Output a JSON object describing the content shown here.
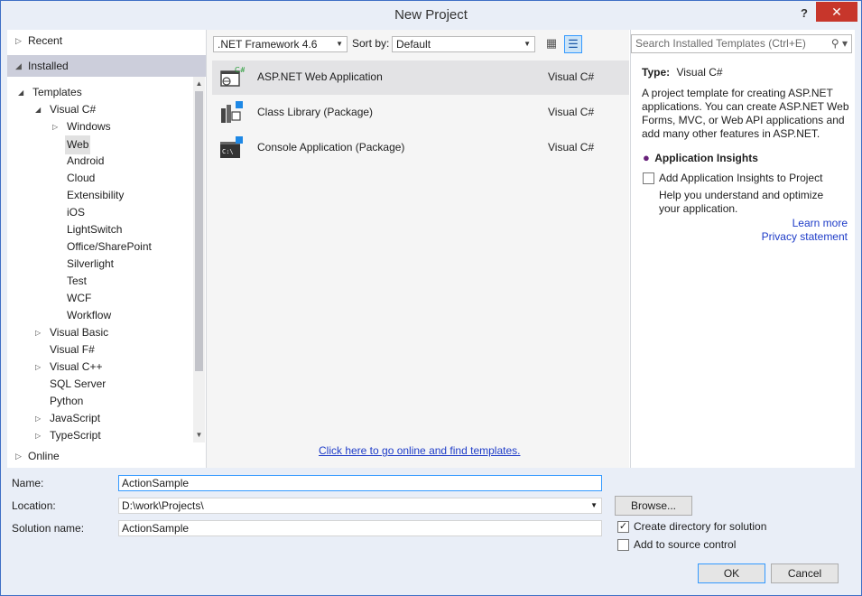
{
  "window": {
    "title": "New Project",
    "help_label": "?",
    "close_label": "✕"
  },
  "left_panel": {
    "recent": "Recent",
    "installed": "Installed",
    "online": "Online",
    "tree": [
      {
        "label": "Templates",
        "level": 0,
        "expander": "◢",
        "selected": false
      },
      {
        "label": "Visual C#",
        "level": 1,
        "expander": "◢",
        "selected": false
      },
      {
        "label": "Windows",
        "level": 2,
        "expander": "▷",
        "selected": false
      },
      {
        "label": "Web",
        "level": 2,
        "expander": "",
        "selected": true
      },
      {
        "label": "Android",
        "level": 2,
        "expander": "",
        "selected": false
      },
      {
        "label": "Cloud",
        "level": 2,
        "expander": "",
        "selected": false
      },
      {
        "label": "Extensibility",
        "level": 2,
        "expander": "",
        "selected": false
      },
      {
        "label": "iOS",
        "level": 2,
        "expander": "",
        "selected": false
      },
      {
        "label": "LightSwitch",
        "level": 2,
        "expander": "",
        "selected": false
      },
      {
        "label": "Office/SharePoint",
        "level": 2,
        "expander": "",
        "selected": false
      },
      {
        "label": "Silverlight",
        "level": 2,
        "expander": "",
        "selected": false
      },
      {
        "label": "Test",
        "level": 2,
        "expander": "",
        "selected": false
      },
      {
        "label": "WCF",
        "level": 2,
        "expander": "",
        "selected": false
      },
      {
        "label": "Workflow",
        "level": 2,
        "expander": "",
        "selected": false
      },
      {
        "label": "Visual Basic",
        "level": 1,
        "expander": "▷",
        "selected": false
      },
      {
        "label": "Visual F#",
        "level": 1,
        "expander": "",
        "selected": false
      },
      {
        "label": "Visual C++",
        "level": 1,
        "expander": "▷",
        "selected": false
      },
      {
        "label": "SQL Server",
        "level": 1,
        "expander": "",
        "selected": false
      },
      {
        "label": "Python",
        "level": 1,
        "expander": "",
        "selected": false
      },
      {
        "label": "JavaScript",
        "level": 1,
        "expander": "▷",
        "selected": false
      },
      {
        "label": "TypeScript",
        "level": 1,
        "expander": "▷",
        "selected": false
      }
    ]
  },
  "toolbar": {
    "framework": ".NET Framework 4.6",
    "sort_label": "Sort by:",
    "sort_value": "Default"
  },
  "templates": [
    {
      "name": "ASP.NET Web Application",
      "lang": "Visual C#",
      "icon": "web-app-icon"
    },
    {
      "name": "Class Library (Package)",
      "lang": "Visual C#",
      "icon": "class-library-icon"
    },
    {
      "name": "Console Application (Package)",
      "lang": "Visual C#",
      "icon": "console-app-icon"
    }
  ],
  "online_link": "Click here to go online and find templates.",
  "right_panel": {
    "search_placeholder": "Search Installed Templates (Ctrl+E)",
    "type_label": "Type:",
    "type_value": "Visual C#",
    "description": "A project template for creating ASP.NET applications. You can create ASP.NET Web Forms, MVC,  or Web API applications and add many other features in ASP.NET.",
    "insights_title": "Application Insights",
    "insights_checkbox": "Add Application Insights to Project",
    "insights_help": "Help you understand and optimize your application.",
    "learn_more": "Learn more",
    "privacy": "Privacy statement"
  },
  "form": {
    "name_label": "Name:",
    "name_value": "ActionSample",
    "location_label": "Location:",
    "location_value": "D:\\work\\Projects\\",
    "solution_label": "Solution name:",
    "solution_value": "ActionSample",
    "browse": "Browse...",
    "create_dir": "Create directory for solution",
    "create_dir_checked": true,
    "source_control": "Add to source control",
    "source_control_checked": false,
    "ok": "OK",
    "cancel": "Cancel"
  },
  "colors": {
    "accent": "#3399ff",
    "close": "#c7362b",
    "link": "#1e3cc8",
    "selected": "#cccedb"
  }
}
